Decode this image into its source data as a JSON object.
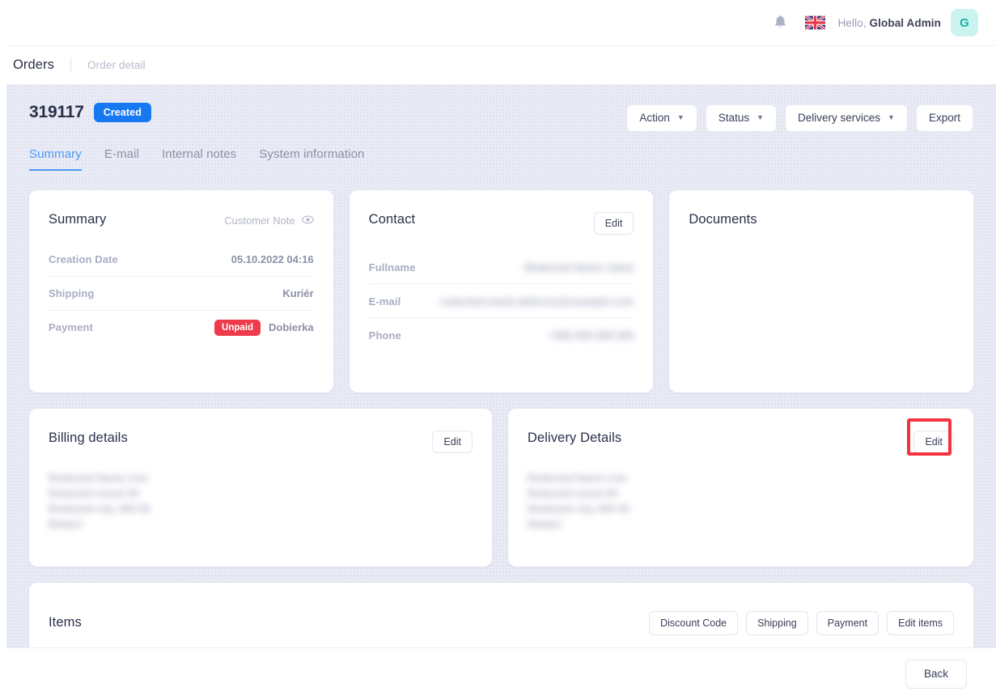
{
  "header": {
    "bell_icon": "bell-icon",
    "language_flag": "uk-flag-icon",
    "greeting_prefix": "Hello,",
    "user_name": "Global Admin",
    "avatar_initial": "G",
    "avatar_bg": "#cbf3f0",
    "avatar_color": "#16b5a6"
  },
  "breadcrumb": {
    "parent": "Orders",
    "current": "Order detail"
  },
  "order": {
    "id": "319117",
    "status_badge": "Created",
    "status_badge_color": "#1778f2",
    "actions": [
      {
        "label": "Action",
        "has_caret": true
      },
      {
        "label": "Status",
        "has_caret": true
      },
      {
        "label": "Delivery services",
        "has_caret": true
      },
      {
        "label": "Export",
        "has_caret": false
      }
    ],
    "tabs": [
      {
        "label": "Summary",
        "active": true
      },
      {
        "label": "E-mail",
        "active": false
      },
      {
        "label": "Internal notes",
        "active": false
      },
      {
        "label": "System information",
        "active": false
      }
    ]
  },
  "summary_card": {
    "title": "Summary",
    "customer_note_label": "Customer Note",
    "customer_note_icon": "eye-icon",
    "rows": [
      {
        "label": "Creation Date",
        "value": "05.10.2022 04:16",
        "badge": null
      },
      {
        "label": "Shipping",
        "value": "Kuriér",
        "badge": null
      },
      {
        "label": "Payment",
        "value": "Dobierka",
        "badge": "Unpaid"
      }
    ],
    "unpaid_badge_color": "#ee3b4b"
  },
  "contact_card": {
    "title": "Contact",
    "edit_label": "Edit",
    "rows": [
      {
        "label": "Fullname",
        "value": "Redacted Name Value"
      },
      {
        "label": "E-mail",
        "value": "redacted.email.address@example.com"
      },
      {
        "label": "Phone",
        "value": "+000 000 000 000"
      }
    ]
  },
  "documents_card": {
    "title": "Documents"
  },
  "billing_card": {
    "title": "Billing details",
    "edit_label": "Edit",
    "address_lines": [
      "Redacted Name Line",
      "Redacted street 00",
      "Redacted city, 000 00",
      "Redact"
    ]
  },
  "delivery_card": {
    "title": "Delivery Details",
    "edit_label": "Edit",
    "highlighted": true,
    "highlight_color": "#f5333f",
    "address_lines": [
      "Redacted Name Line",
      "Redacted street 00",
      "Redacted city, 000 00",
      "Redact"
    ]
  },
  "items_card": {
    "title": "Items",
    "buttons": [
      {
        "label": "Discount Code"
      },
      {
        "label": "Shipping"
      },
      {
        "label": "Payment"
      },
      {
        "label": "Edit items"
      }
    ]
  },
  "footer": {
    "back_label": "Back"
  }
}
